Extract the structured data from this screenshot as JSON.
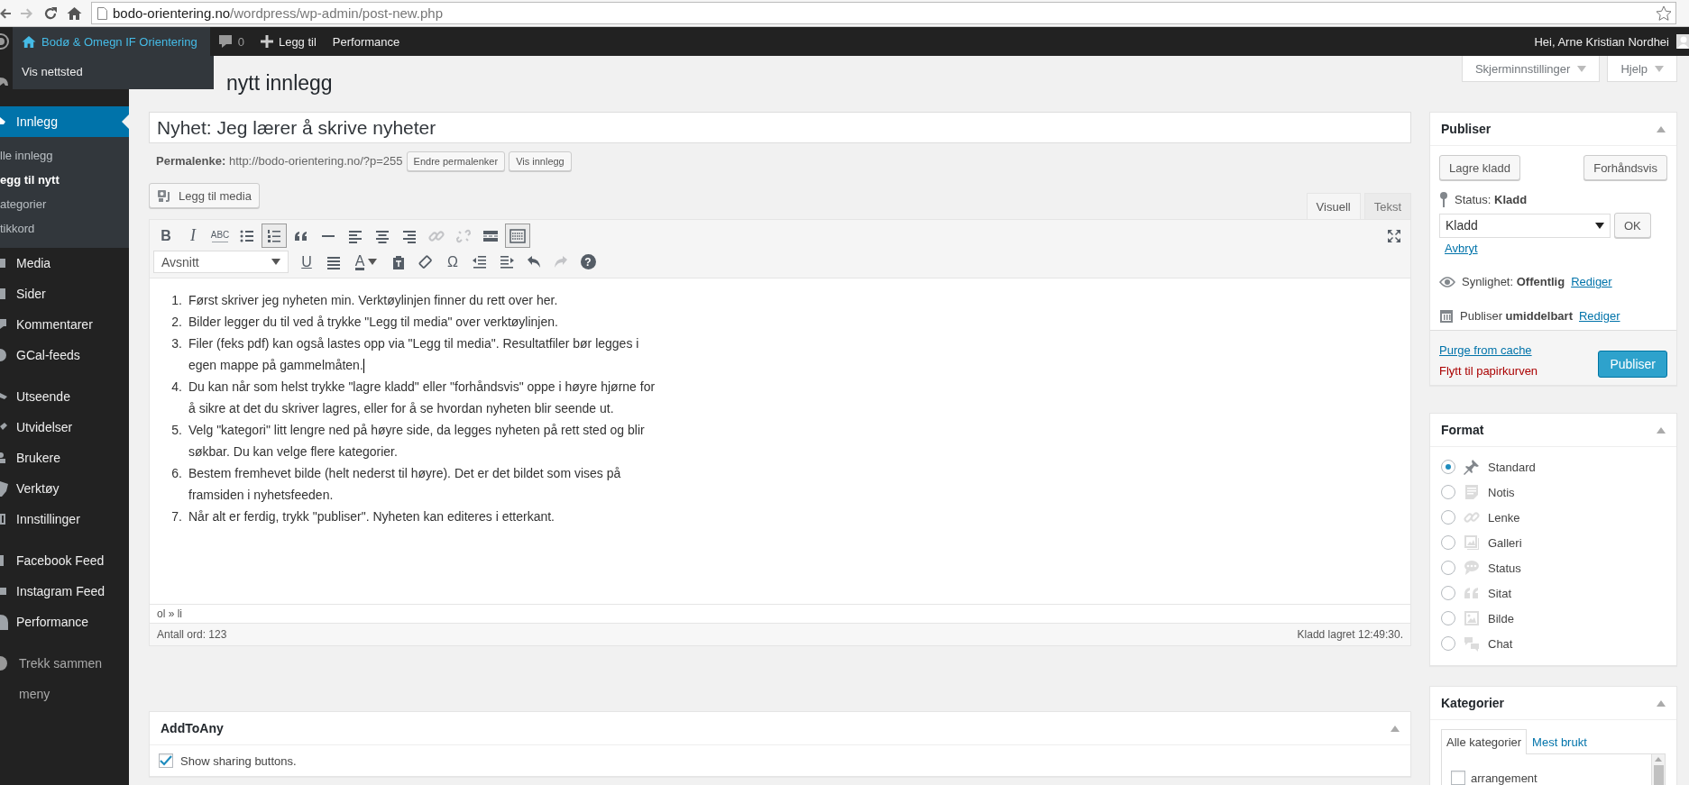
{
  "browser": {
    "url_host": "bodo-orientering.no",
    "url_path": "/wordpress/wp-admin/post-new.php"
  },
  "admin_bar": {
    "site_name": "Bodø & Omegn IF Orientering",
    "comments": "0",
    "new_label": "Legg til",
    "performance": "Performance",
    "greeting": "Hei, Arne Kristian Nordhei",
    "dropdown": [
      "Vis nettsted"
    ]
  },
  "sidebar": {
    "groups": [
      {
        "items": [
          {
            "label": "Innlegg",
            "kind": "pin",
            "selected": true,
            "children": [
              {
                "label": "lle innlegg",
                "selected": false
              },
              {
                "label": "egg til nytt",
                "selected": true
              },
              {
                "label": "ategorier",
                "selected": false
              },
              {
                "label": "tikkord",
                "selected": false
              }
            ]
          },
          {
            "label": "Media",
            "kind": "media",
            "selected": false
          },
          {
            "label": "Sider",
            "kind": "page",
            "selected": false
          },
          {
            "label": "Kommentarer",
            "kind": "comment",
            "selected": false
          },
          {
            "label": "GCal-feeds",
            "kind": "globe",
            "selected": false
          }
        ]
      },
      {
        "items": [
          {
            "label": "Utseende",
            "kind": "brush",
            "selected": false
          },
          {
            "label": "Utvidelser",
            "kind": "plug",
            "selected": false
          },
          {
            "label": "Brukere",
            "kind": "user",
            "selected": false
          },
          {
            "label": "Verktøy",
            "kind": "wrench",
            "selected": false
          },
          {
            "label": "Innstillinger",
            "kind": "sliders",
            "selected": false
          }
        ]
      },
      {
        "items": [
          {
            "label": "Facebook Feed",
            "kind": "bar",
            "selected": false
          },
          {
            "label": "Instagram Feed",
            "kind": "camera",
            "selected": false
          },
          {
            "label": "Performance",
            "kind": "gauge",
            "selected": false
          }
        ]
      }
    ],
    "collapse_label": "Trekk sammen meny"
  },
  "screen_tabs": [
    "Skjerminnstillinger",
    "Hjelp"
  ],
  "page_title": "nytt innlegg",
  "post_title": "Nyhet: Jeg lærer å skrive nyheter",
  "permalink": {
    "text": "**Permalenke:** http://bodo-orientering.no/?p=255",
    "buttons": [
      "Endre permalenker",
      "Vis innlegg"
    ]
  },
  "media_button": "Legg til media",
  "editor": {
    "tabs": [
      {
        "label": "Visuell",
        "selected": true
      },
      {
        "label": "Tekst",
        "selected": false
      }
    ],
    "toolbar_rows": [
      [
        {
          "kind": "bold",
          "label": "B",
          "pressed": false,
          "disabled": false
        },
        {
          "kind": "italic",
          "label": "I",
          "pressed": false,
          "disabled": false
        },
        {
          "kind": "strike",
          "label": "ABC",
          "pressed": false,
          "disabled": false
        },
        {
          "kind": "bullets",
          "pressed": false,
          "disabled": false
        },
        {
          "kind": "numbers",
          "pressed": true,
          "disabled": false
        },
        {
          "kind": "quote",
          "pressed": false,
          "disabled": false
        },
        {
          "kind": "rule",
          "pressed": false,
          "disabled": false
        },
        {
          "kind": "align-left",
          "pressed": false,
          "disabled": false
        },
        {
          "kind": "align-center",
          "pressed": false,
          "disabled": false
        },
        {
          "kind": "align-right",
          "pressed": false,
          "disabled": false
        },
        {
          "kind": "link",
          "pressed": false,
          "disabled": true
        },
        {
          "kind": "unlink",
          "pressed": false,
          "disabled": true
        },
        {
          "kind": "more",
          "pressed": false,
          "disabled": false
        },
        {
          "kind": "toolbar-toggle",
          "pressed": true,
          "disabled": false
        }
      ],
      [
        {
          "kind": "select",
          "label": "Avsnitt"
        },
        {
          "kind": "underline",
          "label": "U",
          "pressed": false,
          "disabled": false
        },
        {
          "kind": "justify",
          "pressed": false,
          "disabled": false
        },
        {
          "kind": "color",
          "label": "A",
          "pressed": false,
          "disabled": false
        },
        {
          "kind": "paste-text",
          "pressed": false,
          "disabled": false
        },
        {
          "kind": "eraser",
          "pressed": false,
          "disabled": false
        },
        {
          "kind": "special",
          "label": "Ω",
          "pressed": false,
          "disabled": false
        },
        {
          "kind": "outdent",
          "pressed": false,
          "disabled": false
        },
        {
          "kind": "indent",
          "pressed": false,
          "disabled": false
        },
        {
          "kind": "undo",
          "pressed": false,
          "disabled": false
        },
        {
          "kind": "redo",
          "pressed": false,
          "disabled": true
        },
        {
          "kind": "help",
          "label": "?",
          "pressed": false,
          "disabled": false
        }
      ]
    ],
    "list": [
      {
        "marker": "1.",
        "text": "Først skriver jeg nyheten min. Verktøylinjen finner du rett over her.",
        "caret": false
      },
      {
        "marker": "2.",
        "text": "Bilder legger du til ved å trykke \"Legg til media\" over verktøylinjen.",
        "caret": false
      },
      {
        "marker": "3.",
        "text": "Filer (feks pdf) kan også lastes opp via \"Legg til media\". Resultatfiler bør legges i egen mappe på gammelmåten.",
        "caret": true
      },
      {
        "marker": "4.",
        "text": "Du kan når som helst trykke \"lagre kladd\" eller \"forhåndsvis\" oppe i høyre hjørne for å sikre at det du skriver lagres, eller for å se hvordan nyheten blir seende ut.",
        "caret": false
      },
      {
        "marker": "5.",
        "text": "Velg \"kategori\" litt lengre ned på høyre side, da legges nyheten på rett sted og blir søkbar. Du kan velge flere kategorier.",
        "caret": false
      },
      {
        "marker": "6.",
        "text": "Bestem fremhevet bilde (helt nederst til høyre). Det er det bildet som vises på framsiden i nyhetsfeeden.",
        "caret": false
      },
      {
        "marker": "7.",
        "text": "Når alt er ferdig, trykk \"publiser\". Nyheten kan editeres i etterkant.",
        "caret": false
      }
    ],
    "path": "ol » li",
    "word_count": "Antall ord: 123",
    "saved": "Kladd lagret 12:49:30."
  },
  "addtoany": {
    "title": "AddToAny",
    "option": {
      "label": "Show sharing buttons.",
      "checked": true
    }
  },
  "publish": {
    "title": "Publiser",
    "save_draft": "Lagre kladd",
    "preview": "Forhåndsvis",
    "status": "Status: **Kladd**",
    "status_value": "Kladd",
    "ok": "OK",
    "cancel": "Avbryt",
    "visibility": "Synlighet: **Offentlig**",
    "visibility_edit": "Rediger",
    "schedule": "Publiser **umiddelbart**",
    "schedule_edit": "Rediger",
    "purge": "Purge from cache",
    "trash": "Flytt til papirkurven",
    "publish_button": "Publiser"
  },
  "format": {
    "title": "Format",
    "options": [
      {
        "label": "Standard",
        "kind": "pin",
        "selected": true
      },
      {
        "label": "Notis",
        "kind": "note",
        "selected": false
      },
      {
        "label": "Lenke",
        "kind": "link",
        "selected": false
      },
      {
        "label": "Galleri",
        "kind": "gallery",
        "selected": false
      },
      {
        "label": "Status",
        "kind": "bubble",
        "selected": false
      },
      {
        "label": "Sitat",
        "kind": "quote",
        "selected": false
      },
      {
        "label": "Bilde",
        "kind": "image",
        "selected": false
      },
      {
        "label": "Chat",
        "kind": "chat",
        "selected": false
      }
    ]
  },
  "categories": {
    "title": "Kategorier",
    "tabs": [
      {
        "label": "Alle kategorier",
        "selected": true
      },
      {
        "label": "Mest brukt",
        "selected": false
      }
    ],
    "items": [
      {
        "label": "arrangement",
        "checked": false
      }
    ]
  }
}
